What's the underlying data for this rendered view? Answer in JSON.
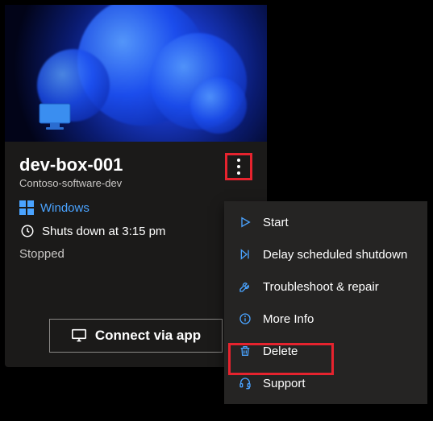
{
  "card": {
    "name": "dev-box-001",
    "subtitle": "Contoso-software-dev",
    "os_label": "Windows",
    "schedule_text": "Shuts down at 3:15 pm",
    "status": "Stopped",
    "connect_label": "Connect via app"
  },
  "menu": {
    "start": "Start",
    "delay": "Delay scheduled shutdown",
    "troubleshoot": "Troubleshoot & repair",
    "more_info": "More Info",
    "delete": "Delete",
    "support": "Support"
  }
}
